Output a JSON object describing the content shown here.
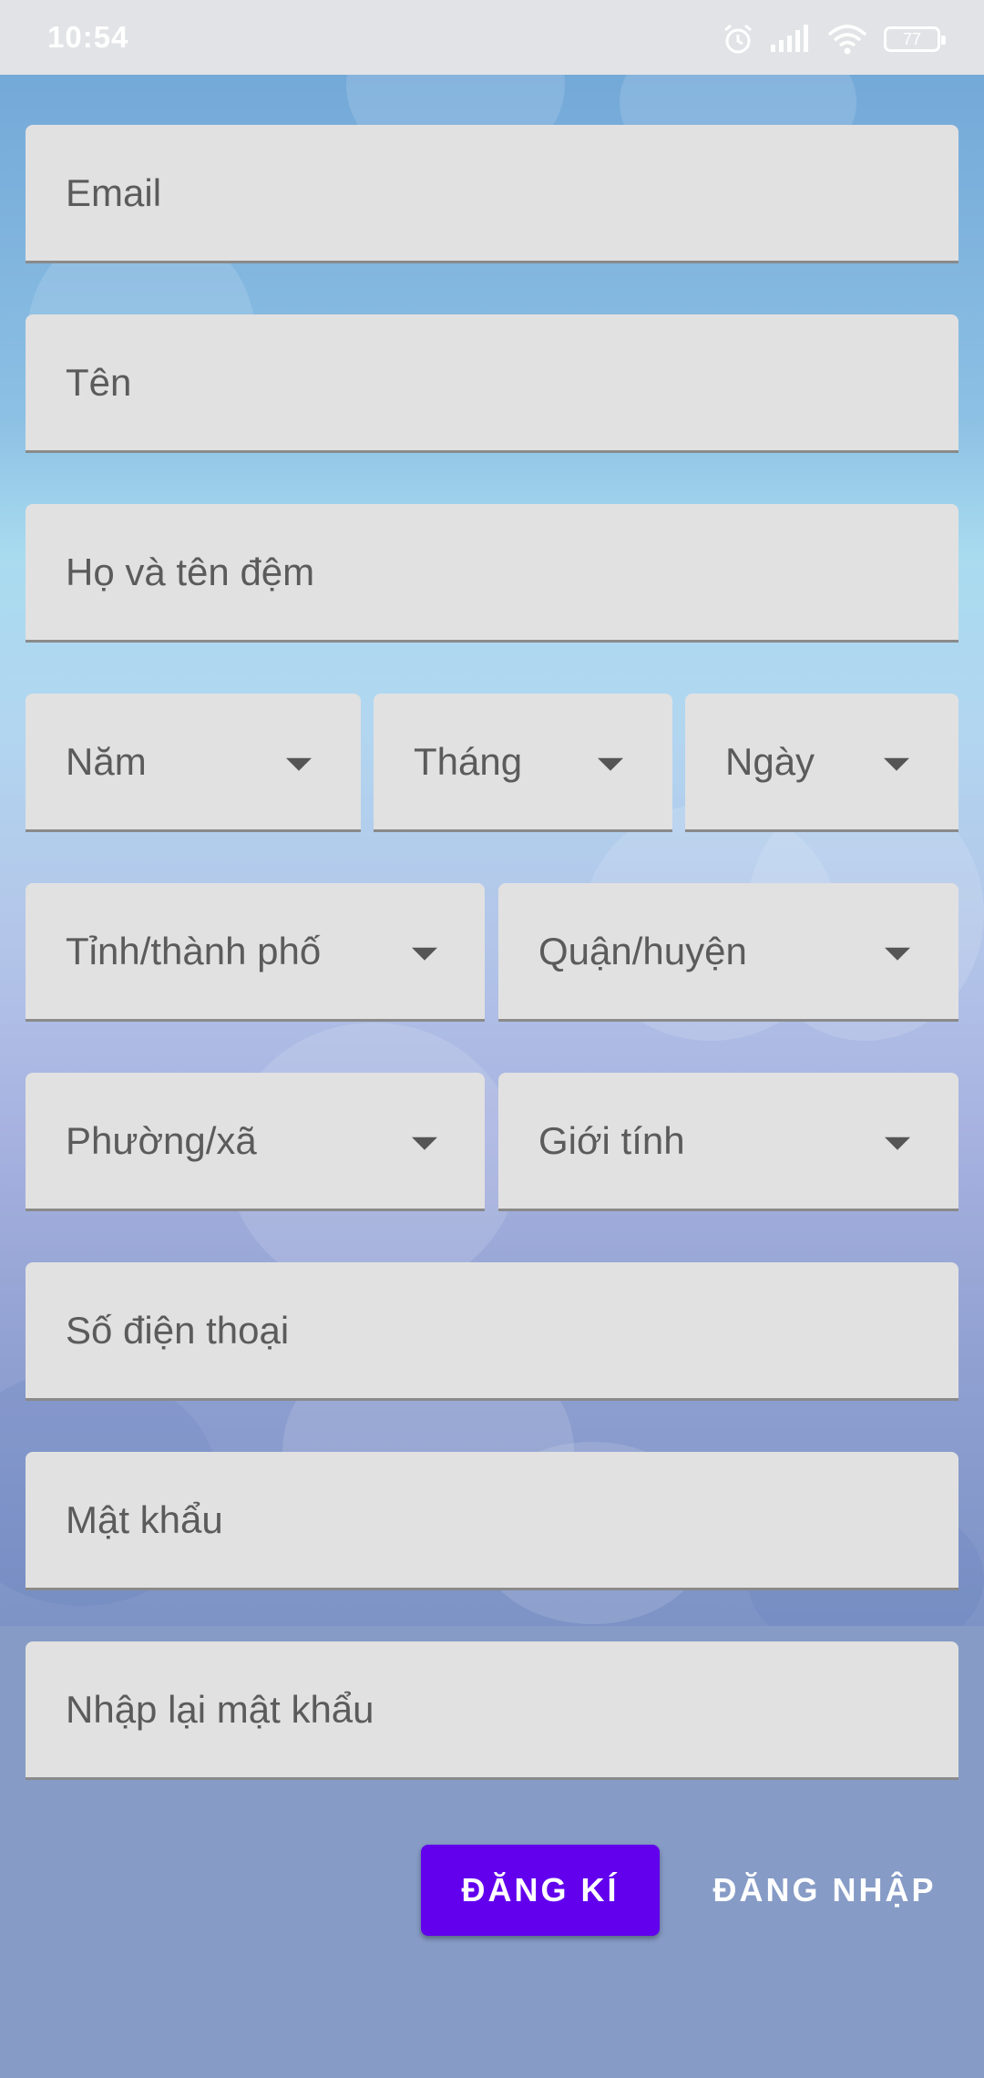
{
  "status_bar": {
    "time": "10:54",
    "battery": "77",
    "icons": [
      "alarm-icon",
      "signal-icon",
      "wifi-icon",
      "battery-icon"
    ]
  },
  "form": {
    "email": "Email",
    "first_name": "Tên",
    "last_middle_name": "Họ và tên đệm",
    "year": "Năm",
    "month": "Tháng",
    "day": "Ngày",
    "province": "Tỉnh/thành phố",
    "district": "Quận/huyện",
    "ward": "Phường/xã",
    "gender": "Giới tính",
    "phone": "Số điện thoại",
    "password": "Mật khẩu",
    "confirm_password": "Nhập lại mật khẩu"
  },
  "actions": {
    "register": "ĐĂNG KÍ",
    "login": "ĐĂNG NHẬP"
  },
  "colors": {
    "primary": "#6200ee",
    "field_bg": "#e1e1e1",
    "page_bg": "#869bc6"
  }
}
